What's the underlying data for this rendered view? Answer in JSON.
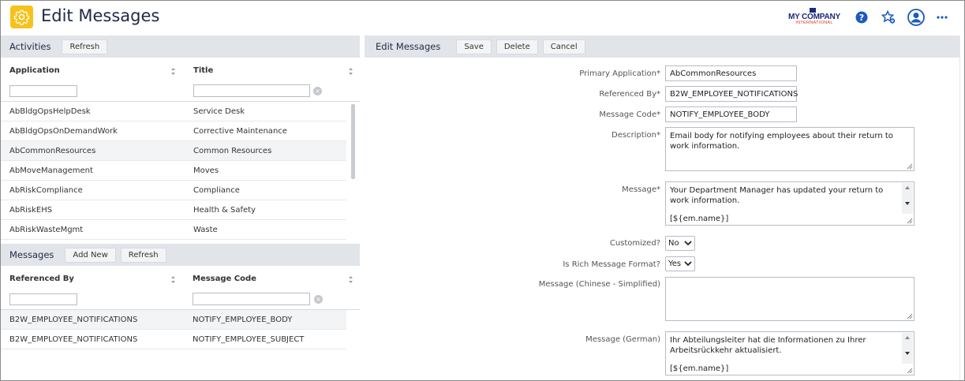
{
  "header": {
    "title": "Edit Messages",
    "logo_line1": "MY COMPANY",
    "logo_line2": "INTERNATIONAL",
    "icons": [
      "help-icon",
      "favorites-star-icon",
      "user-avatar-icon",
      "more-icon"
    ]
  },
  "activities": {
    "title": "Activities",
    "refresh_label": "Refresh",
    "columns": [
      "Application",
      "Title"
    ],
    "rows": [
      {
        "application": "AbBldgOpsHelpDesk",
        "title": "Service Desk"
      },
      {
        "application": "AbBldgOpsOnDemandWork",
        "title": "Corrective Maintenance"
      },
      {
        "application": "AbCommonResources",
        "title": "Common Resources"
      },
      {
        "application": "AbMoveManagement",
        "title": "Moves"
      },
      {
        "application": "AbRiskCompliance",
        "title": "Compliance"
      },
      {
        "application": "AbRiskEHS",
        "title": "Health & Safety"
      },
      {
        "application": "AbRiskWasteMgmt",
        "title": "Waste"
      }
    ]
  },
  "messages": {
    "title": "Messages",
    "add_new_label": "Add New",
    "refresh_label": "Refresh",
    "columns": [
      "Referenced By",
      "Message Code"
    ],
    "rows": [
      {
        "referenced_by": "B2W_EMPLOYEE_NOTIFICATIONS",
        "message_code": "NOTIFY_EMPLOYEE_BODY"
      },
      {
        "referenced_by": "B2W_EMPLOYEE_NOTIFICATIONS",
        "message_code": "NOTIFY_EMPLOYEE_SUBJECT"
      }
    ]
  },
  "edit": {
    "title": "Edit Messages",
    "save_label": "Save",
    "delete_label": "Delete",
    "cancel_label": "Cancel",
    "fields": {
      "primary_application": {
        "label": "Primary Application*",
        "value": "AbCommonResources"
      },
      "referenced_by": {
        "label": "Referenced By*",
        "value": "B2W_EMPLOYEE_NOTIFICATIONS"
      },
      "message_code": {
        "label": "Message Code*",
        "value": "NOTIFY_EMPLOYEE_BODY"
      },
      "description": {
        "label": "Description*",
        "value": "Email body for notifying employees about their return to work information."
      },
      "message": {
        "label": "Message*",
        "line1": "Your Department Manager has updated your return to work information.",
        "line2": "[${em.name}]"
      },
      "customized": {
        "label": "Customized?",
        "value": "No"
      },
      "rich_format": {
        "label": "Is Rich Message Format?",
        "value": "Yes"
      },
      "message_chinese": {
        "label": "Message (Chinese - Simplified)",
        "value": ""
      },
      "message_german": {
        "label": "Message (German)",
        "line1": "Ihr Abteilungsleiter hat die Informationen zu Ihrer Arbeitsrückkehr aktualisiert.",
        "line2": "[${em.name}]"
      }
    }
  },
  "colors": {
    "accent": "#f6c21b",
    "panel_header": "#e1e4e9",
    "title_text": "#1f2a44",
    "icon_blue": "#1b5bbd"
  }
}
